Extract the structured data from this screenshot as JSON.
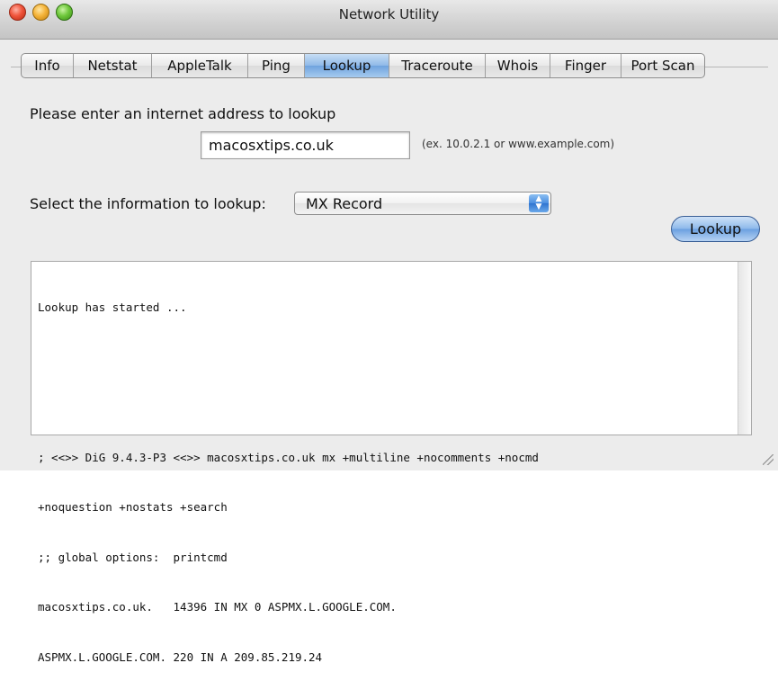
{
  "window": {
    "title": "Network Utility"
  },
  "tabs": [
    {
      "label": "Info",
      "active": false
    },
    {
      "label": "Netstat",
      "active": false
    },
    {
      "label": "AppleTalk",
      "active": false
    },
    {
      "label": "Ping",
      "active": false
    },
    {
      "label": "Lookup",
      "active": true
    },
    {
      "label": "Traceroute",
      "active": false
    },
    {
      "label": "Whois",
      "active": false
    },
    {
      "label": "Finger",
      "active": false
    },
    {
      "label": "Port Scan",
      "active": false
    }
  ],
  "lookup": {
    "prompt": "Please enter an internet address to lookup",
    "address_value": "macosxtips.co.uk",
    "example_hint": "(ex. 10.0.2.1 or www.example.com)",
    "select_label": "Select the information to lookup:",
    "select_value": "MX Record",
    "button_label": "Lookup"
  },
  "output": {
    "lines": [
      "Lookup has started ...",
      "",
      "",
      "; <<>> DiG 9.4.3-P3 <<>> macosxtips.co.uk mx +multiline +nocomments +nocmd",
      "+noquestion +nostats +search",
      ";; global options:  printcmd",
      "macosxtips.co.uk.   14396 IN MX 0 ASPMX.L.GOOGLE.COM.",
      "ASPMX.L.GOOGLE.COM. 220 IN A 209.85.219.24"
    ]
  },
  "colors": {
    "active_tab": "#8fb9e8",
    "button_blue": "#8cb8ea",
    "close": "#f0553c",
    "minimize": "#f5b43a",
    "zoom": "#6fc83c"
  },
  "icons": {
    "close": "close-icon",
    "minimize": "minimize-icon",
    "zoom": "zoom-icon",
    "select_arrows": "updown-arrows-icon",
    "resize": "resize-grip-icon"
  }
}
